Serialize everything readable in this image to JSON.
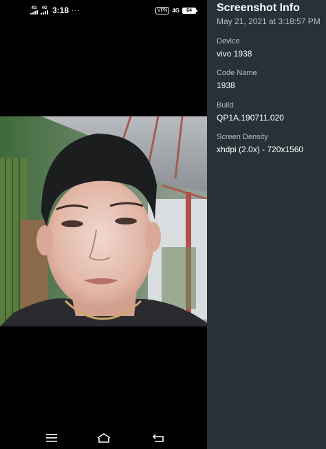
{
  "status_bar": {
    "sim1": "4G",
    "sim2": "4G",
    "time": "3:18",
    "more": "···",
    "vpn": "VPN",
    "network": "4G",
    "battery": "64"
  },
  "info_panel": {
    "title": "Screenshot Info",
    "date": "May 21, 2021 at 3:18:57 PM",
    "fields": [
      {
        "label": "Device",
        "value": "vivo 1938"
      },
      {
        "label": "Code Name",
        "value": "1938"
      },
      {
        "label": "Build",
        "value": "QP1A.190711.020"
      },
      {
        "label": "Screen Density",
        "value": "xhdpi (2.0x) - 720x1560"
      }
    ]
  },
  "navbar": {
    "icons": [
      "menu-icon",
      "home-icon",
      "back-icon"
    ]
  },
  "colors": {
    "panel_bg": "#263238",
    "panel_label": "#b0bec5"
  }
}
